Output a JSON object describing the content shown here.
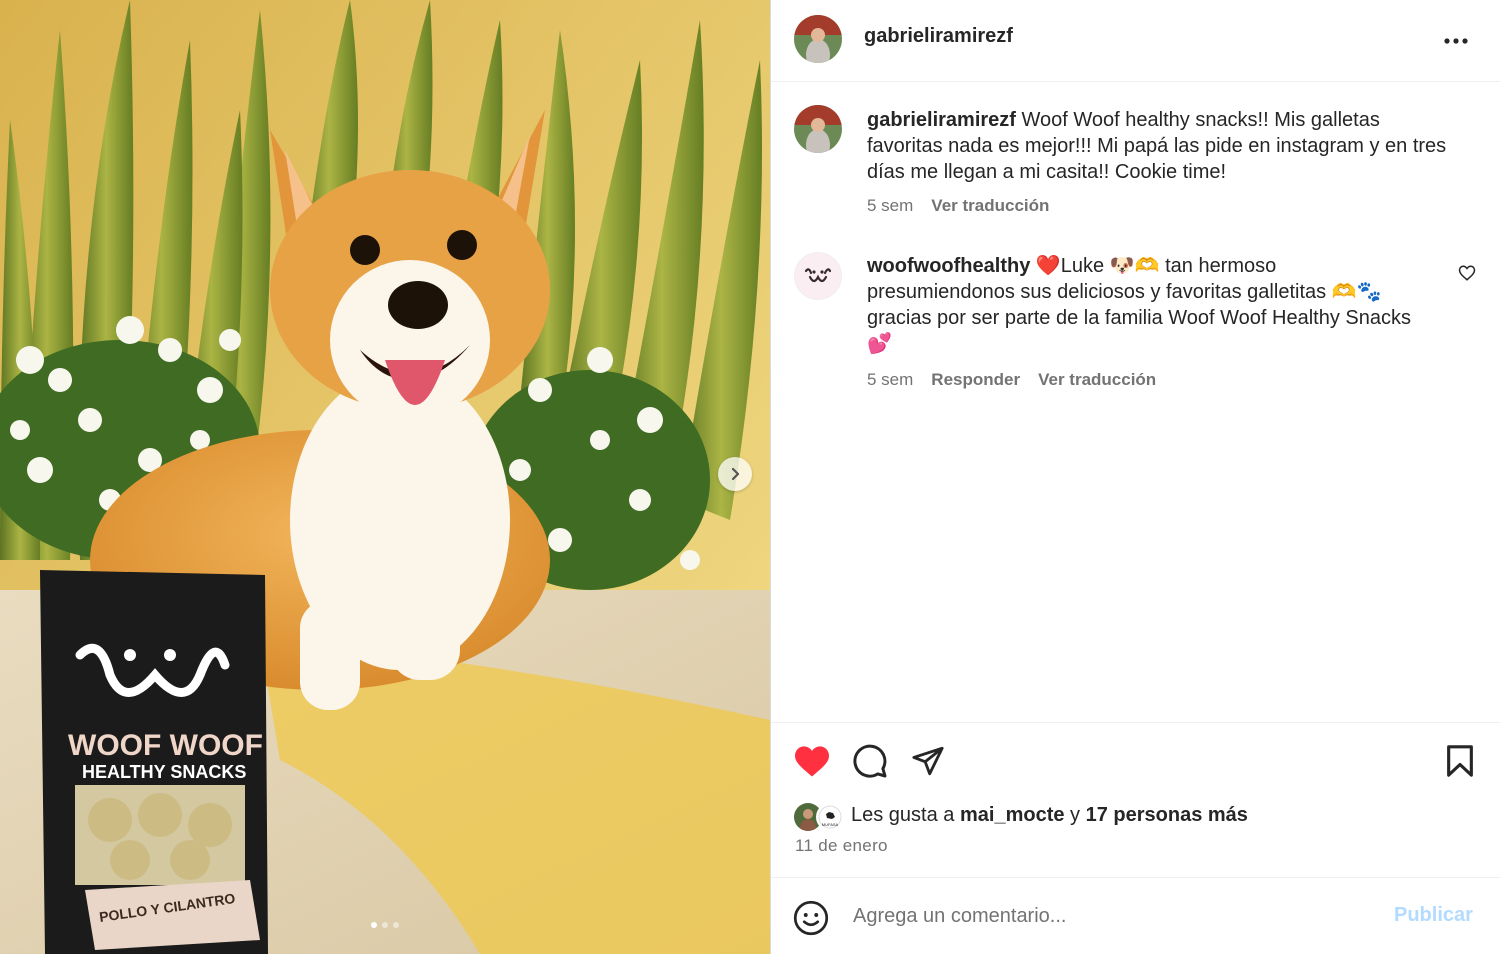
{
  "post": {
    "author": "gabrieliramirezf",
    "caption": "Woof Woof healthy snacks!! Mis galletas favoritas nada es mejor!!! Mi papá las pide en instagram y en tres días me llegan a mi casita!! Cookie time!",
    "caption_time": "5 sem",
    "caption_translate": "Ver traducción"
  },
  "comments": [
    {
      "username": "woofwoofhealthy",
      "text": "❤️Luke 🐶🫶 tan hermoso presumiendonos sus deliciosos y favoritas galletitas 🫶🐾 gracias por ser parte de la familia Woof Woof Healthy Snacks 💕",
      "time": "5 sem",
      "reply": "Responder",
      "translate": "Ver traducción"
    }
  ],
  "likes": {
    "prefix": "Les gusta a",
    "user": "mai_mocte",
    "connector": "y",
    "others": "17 personas más",
    "avatar_badge": "MUFASA"
  },
  "date": "11 de enero",
  "add_comment": {
    "placeholder": "Agrega un comentario...",
    "publish": "Publicar"
  },
  "product": {
    "brand_line1": "WOOF WOOF",
    "brand_line2": "HEALTHY SNACKS",
    "flavor": "POLLO Y CILANTRO"
  },
  "colors": {
    "heart_red": "#ff3040",
    "publish_blue": "#b3dbff",
    "muted_text": "#737373"
  },
  "carousel": {
    "current": 1,
    "total": 3
  }
}
